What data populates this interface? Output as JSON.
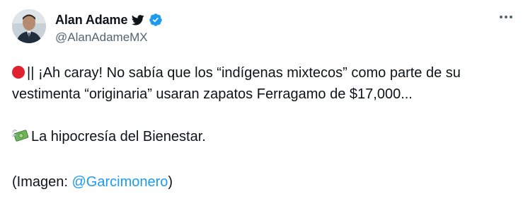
{
  "author": {
    "display_name": "Alan Adame",
    "handle": "@AlanAdameMX"
  },
  "icons": {
    "bird": "twitter-bird-icon",
    "verified": "verified-badge-icon",
    "more": "more-options-icon",
    "red_circle": "red-circle-emoji",
    "money": "money-with-wings-emoji"
  },
  "colors": {
    "text": "#0f1419",
    "secondary": "#536471",
    "link": "#1d9bf0",
    "verified": "#1d9bf0",
    "red_emoji": "#e0212e"
  },
  "tweet": {
    "line1_prefix": "|| ¡Ah caray! No sabía que los “indígenas mixtecos” como parte de su",
    "line2": "vestimenta “originaria” usaran zapatos Ferragamo  de $17,000...",
    "line3": "La hipocresía del Bienestar.",
    "line4_prefix": "(Imagen: ",
    "mention": "@Garcimonero",
    "line4_suffix": ")"
  }
}
